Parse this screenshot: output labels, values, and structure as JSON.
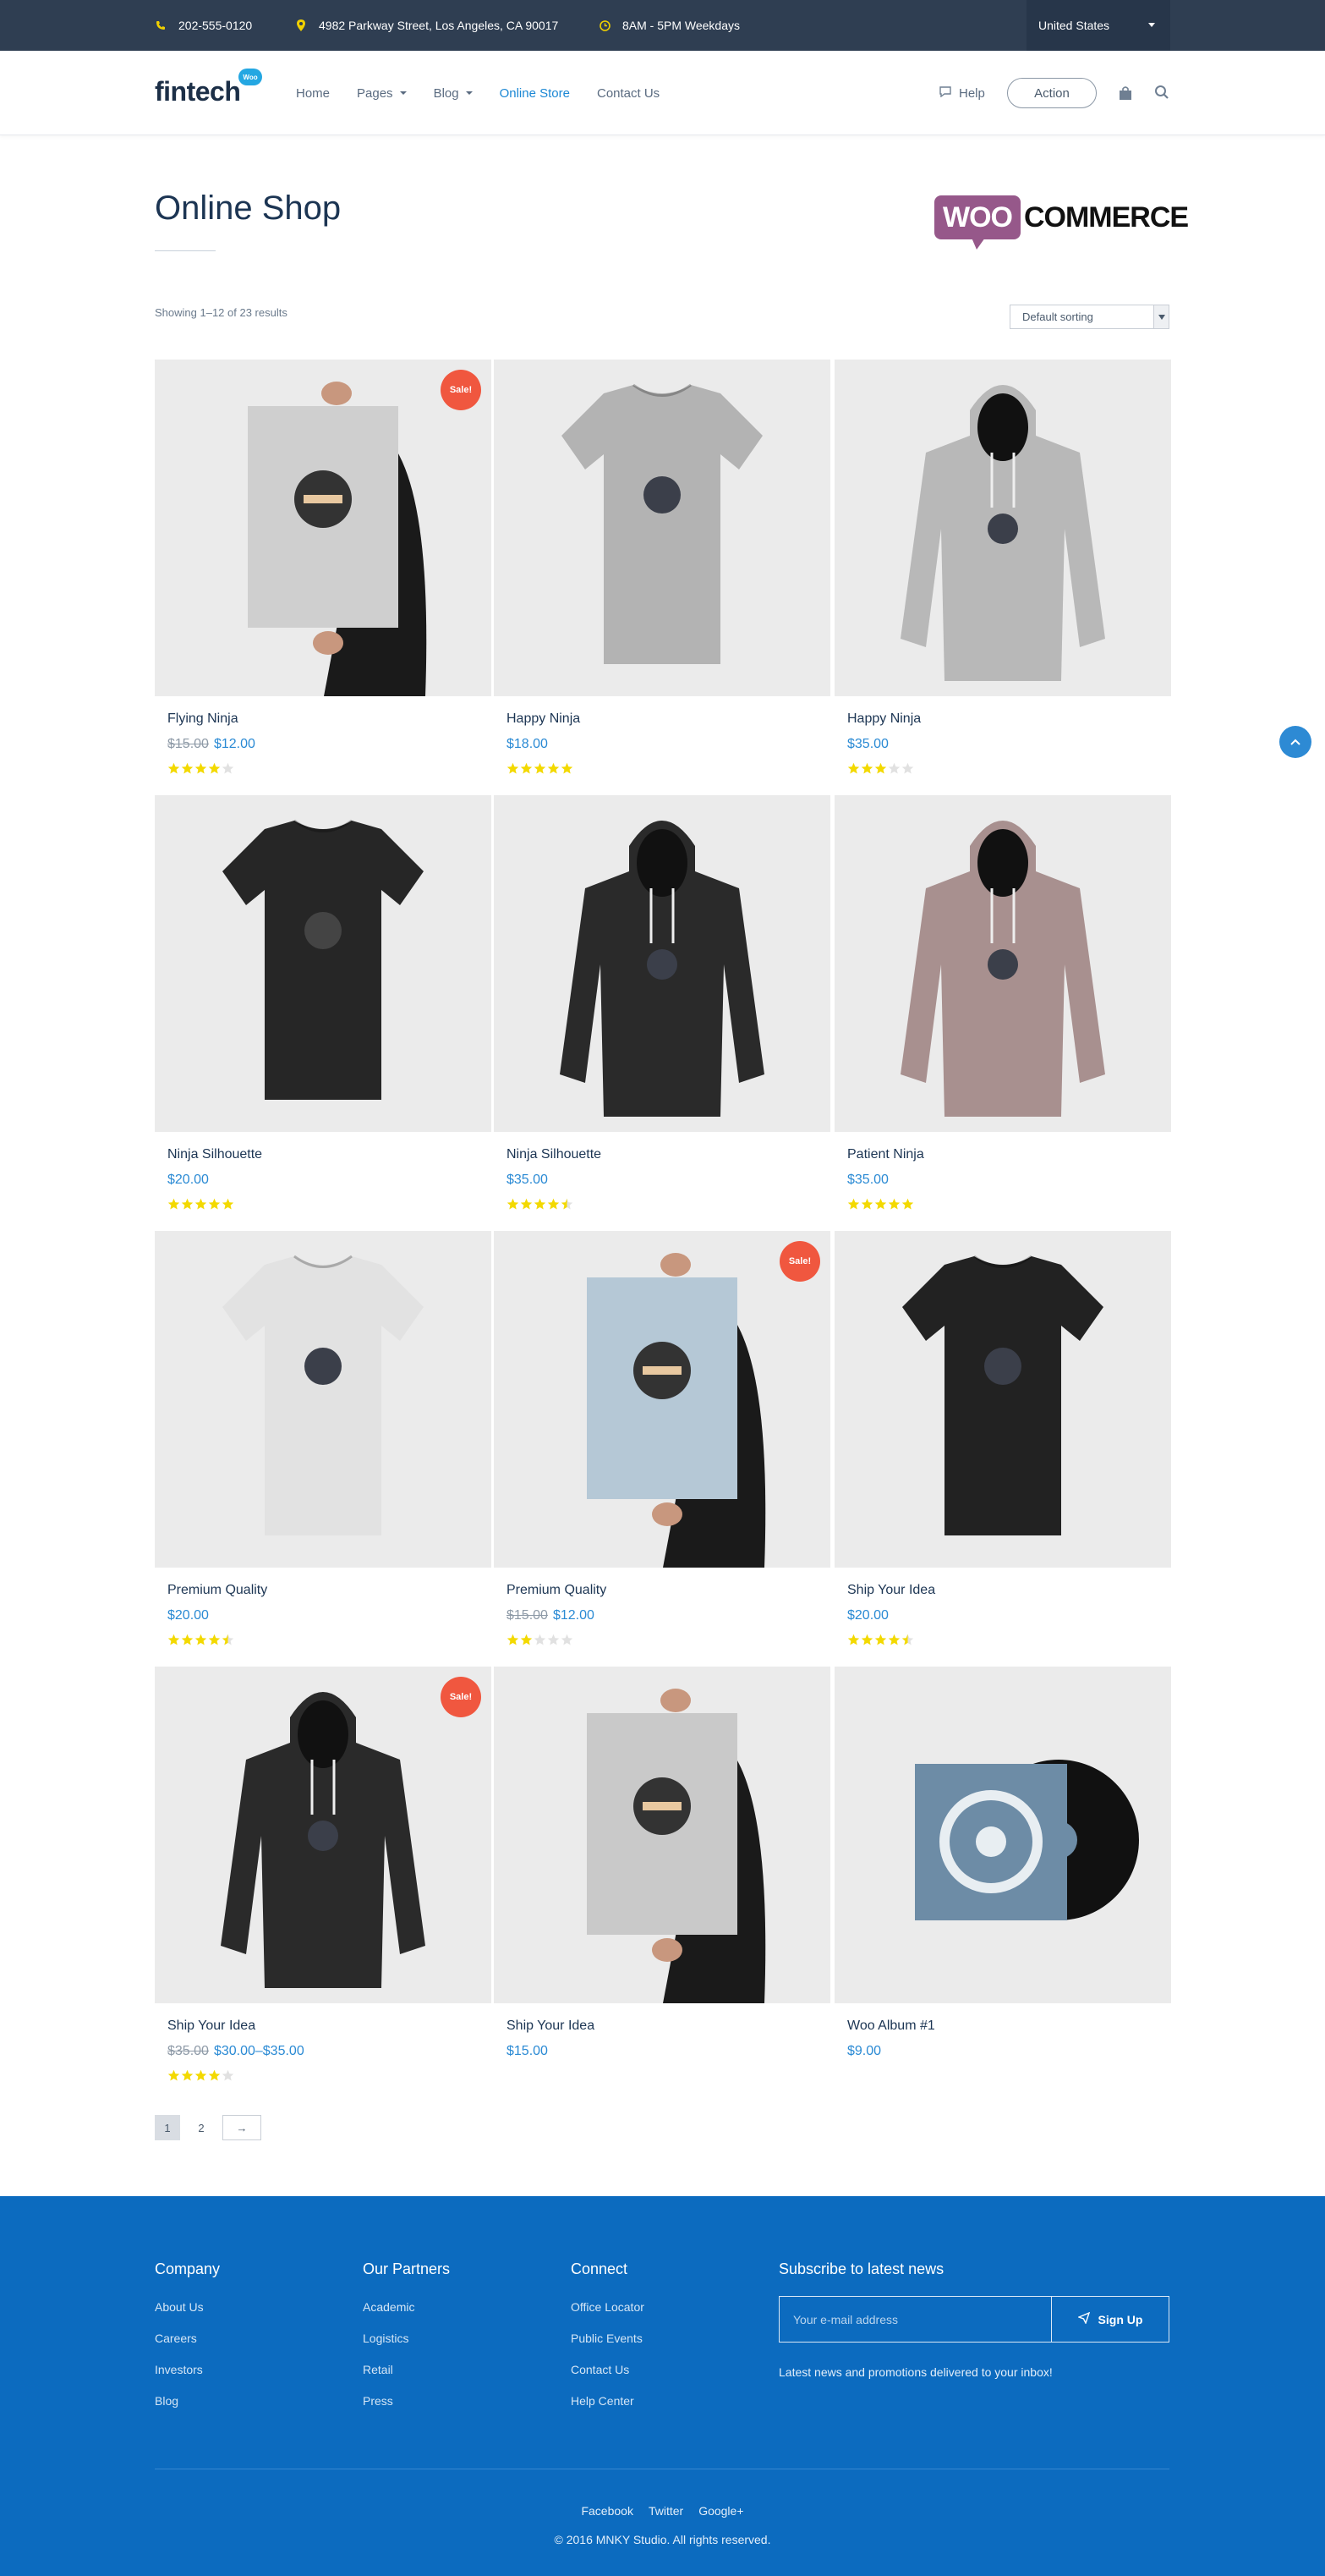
{
  "topbar": {
    "phone": "202-555-0120",
    "address": "4982 Parkway Street, Los Angeles, CA 90017",
    "hours": "8AM - 5PM Weekdays",
    "country": "United States"
  },
  "header": {
    "logo": "fintech",
    "logo_badge": "Woo",
    "nav": [
      {
        "label": "Home",
        "dropdown": false,
        "active": false
      },
      {
        "label": "Pages",
        "dropdown": true,
        "active": false
      },
      {
        "label": "Blog",
        "dropdown": true,
        "active": false
      },
      {
        "label": "Online Store",
        "dropdown": false,
        "active": true
      },
      {
        "label": "Contact Us",
        "dropdown": false,
        "active": false
      }
    ],
    "help": "Help",
    "action": "Action"
  },
  "page": {
    "title": "Online Shop",
    "brand_left": "WOO",
    "brand_right": "COMMERCE",
    "result_count": "Showing 1–12 of 23 results",
    "sorting": "Default sorting"
  },
  "products": [
    {
      "name": "Flying Ninja",
      "old_price": "$15.00",
      "price": "$12.00",
      "rating": 4,
      "sale": true,
      "visual": "poster-ninja"
    },
    {
      "name": "Happy Ninja",
      "old_price": "",
      "price": "$18.00",
      "rating": 5,
      "sale": false,
      "visual": "tshirt-grey"
    },
    {
      "name": "Happy Ninja",
      "old_price": "",
      "price": "$35.00",
      "rating": 3,
      "sale": false,
      "visual": "hoodie-grey"
    },
    {
      "name": "Ninja Silhouette",
      "old_price": "",
      "price": "$20.00",
      "rating": 5,
      "sale": false,
      "visual": "tshirt-black"
    },
    {
      "name": "Ninja Silhouette",
      "old_price": "",
      "price": "$35.00",
      "rating": 4.5,
      "sale": false,
      "visual": "hoodie-black"
    },
    {
      "name": "Patient Ninja",
      "old_price": "",
      "price": "$35.00",
      "rating": 5,
      "sale": false,
      "visual": "hoodie-pink"
    },
    {
      "name": "Premium Quality",
      "old_price": "",
      "price": "$20.00",
      "rating": 4.5,
      "sale": false,
      "visual": "tshirt-white"
    },
    {
      "name": "Premium Quality",
      "old_price": "$15.00",
      "price": "$12.00",
      "rating": 2,
      "sale": true,
      "visual": "poster-blue"
    },
    {
      "name": "Ship Your Idea",
      "old_price": "",
      "price": "$20.00",
      "rating": 4.5,
      "sale": false,
      "visual": "tshirt-skull"
    },
    {
      "name": "Ship Your Idea",
      "old_price": "$35.00",
      "price": "$30.00–$35.00",
      "rating": 4,
      "sale": true,
      "visual": "hoodie-skull"
    },
    {
      "name": "Ship Your Idea",
      "old_price": "",
      "price": "$15.00",
      "rating": 0,
      "sale": false,
      "visual": "poster-skull"
    },
    {
      "name": "Woo Album #1",
      "old_price": "",
      "price": "$9.00",
      "rating": 0,
      "sale": false,
      "visual": "album"
    }
  ],
  "sale_label": "Sale!",
  "pagination": {
    "pages": [
      "1",
      "2"
    ],
    "next": "→"
  },
  "footer": {
    "columns": [
      {
        "title": "Company",
        "links": [
          "About Us",
          "Careers",
          "Investors",
          "Blog"
        ]
      },
      {
        "title": "Our Partners",
        "links": [
          "Academic",
          "Logistics",
          "Retail",
          "Press"
        ]
      },
      {
        "title": "Connect",
        "links": [
          "Office Locator",
          "Public Events",
          "Contact Us",
          "Help Center"
        ]
      }
    ],
    "subscribe_title": "Subscribe to latest news",
    "email_placeholder": "Your e-mail address",
    "signup": "Sign Up",
    "subscribe_note": "Latest news and promotions delivered to your inbox!",
    "social": [
      "Facebook",
      "Twitter",
      "Google+"
    ],
    "copyright": "© 2016 MNKY Studio. All rights reserved."
  },
  "colors": {
    "topbar": "#2f3e52",
    "accent": "#2a8ad4",
    "sale": "#f0573f",
    "star": "#f3d900",
    "footer": "#0c6bbf",
    "woo": "#96588a"
  }
}
